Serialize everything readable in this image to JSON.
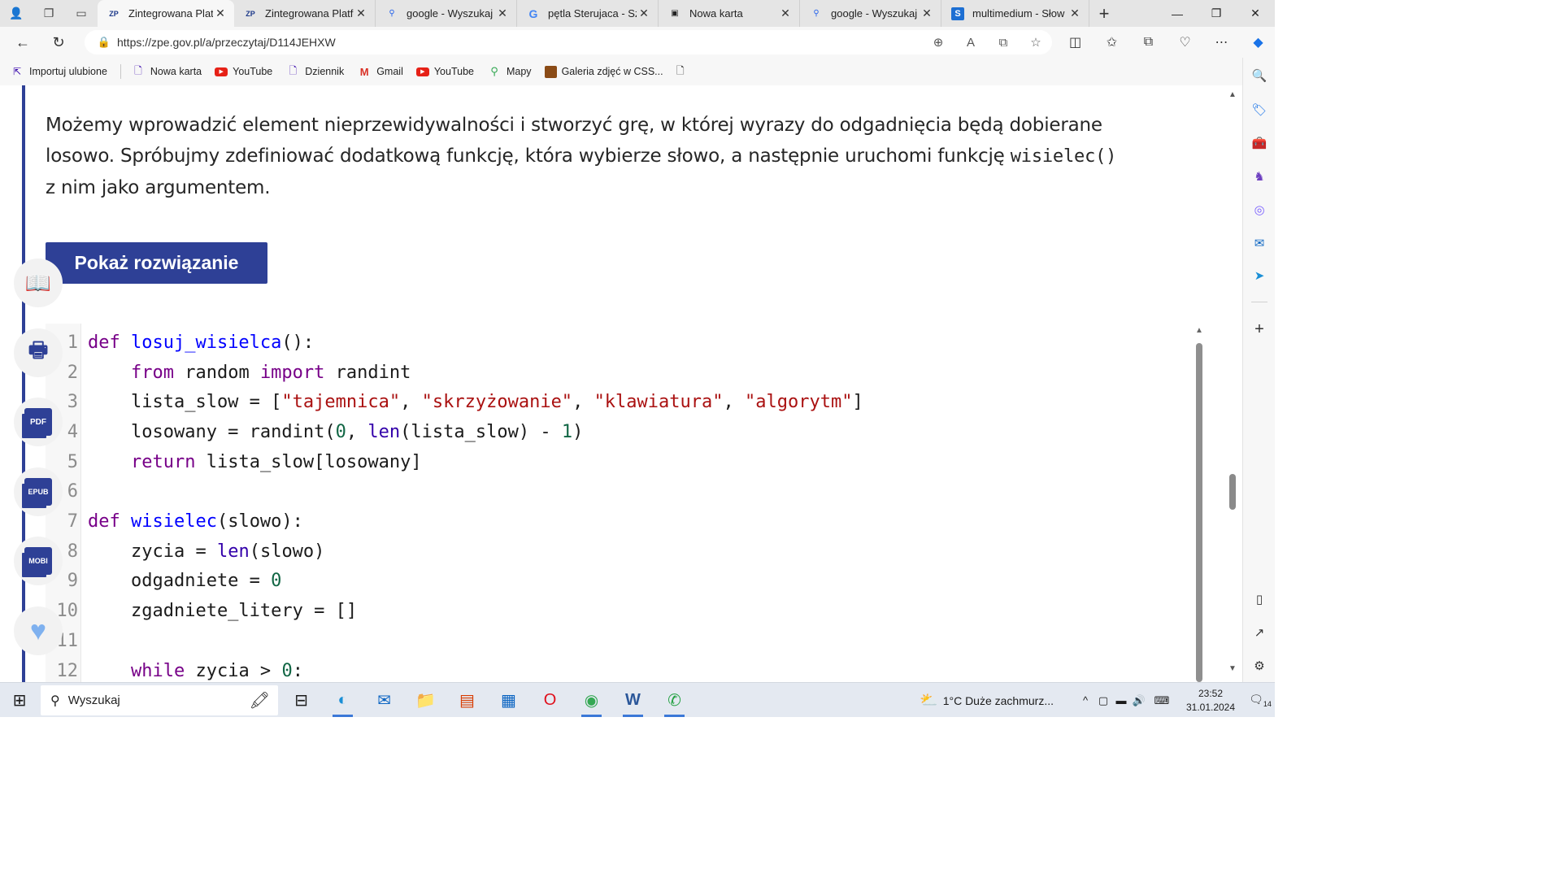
{
  "browser": {
    "tabs": [
      {
        "title": "Zintegrowana Platfo",
        "favicon": "zpe-icon",
        "favicon_text": "ZP"
      },
      {
        "title": "Zintegrowana Platfo",
        "favicon": "zpe-icon",
        "favicon_text": "ZP"
      },
      {
        "title": "google - Wyszukaj",
        "favicon": "search-icon",
        "favicon_text": "⚲"
      },
      {
        "title": "pętla Sterujaca - Szu",
        "favicon": "google-icon",
        "favicon_text": "G"
      },
      {
        "title": "Nowa karta",
        "favicon": "new-tab-icon",
        "favicon_text": "▣"
      },
      {
        "title": "google - Wyszukaj",
        "favicon": "search-icon",
        "favicon_text": "⚲"
      },
      {
        "title": "multimedium - Słow",
        "favicon": "sjp-icon",
        "favicon_text": "S"
      }
    ],
    "active_tab_index": 0,
    "url": "https://zpe.gov.pl/a/przeczytaj/D114JEHXW",
    "bookmarks": [
      {
        "label": "Importuj ulubione",
        "icon": "import-icon"
      },
      {
        "label": "Nowa karta",
        "icon": "page-icon"
      },
      {
        "label": "YouTube",
        "icon": "youtube-icon"
      },
      {
        "label": "Dziennik",
        "icon": "page-icon"
      },
      {
        "label": "Gmail",
        "icon": "gmail-icon"
      },
      {
        "label": "YouTube",
        "icon": "youtube-icon"
      },
      {
        "label": "Mapy",
        "icon": "maps-icon"
      },
      {
        "label": "Galeria zdjęć w CSS...",
        "icon": "gallery-icon"
      }
    ]
  },
  "content": {
    "paragraph_before": "Możemy wprowadzić element nieprzewidywalności i stworzyć grę, w której wyrazy do odgadnięcia będą dobierane losowo. Spróbujmy zdefiniować dodatkową funkcję, która wybierze słowo, a następnie uruchomi funkcję ",
    "paragraph_code": "wisielec()",
    "paragraph_after": " z nim jako argumentem.",
    "solution_button": "Pokaż rozwiązanie",
    "code_lines": [
      {
        "n": "1",
        "tokens": [
          [
            "kw",
            "def "
          ],
          [
            "fn",
            "losuj_wisielca"
          ],
          [
            "",
            "():"
          ]
        ]
      },
      {
        "n": "2",
        "tokens": [
          [
            "",
            "    "
          ],
          [
            "kw",
            "from"
          ],
          [
            "",
            " random "
          ],
          [
            "kw",
            "import"
          ],
          [
            "",
            " randint"
          ]
        ]
      },
      {
        "n": "3",
        "tokens": [
          [
            "",
            "    lista_slow = ["
          ],
          [
            "st",
            "\"tajemnica\""
          ],
          [
            "",
            ", "
          ],
          [
            "st",
            "\"skrzyżowanie\""
          ],
          [
            "",
            ", "
          ],
          [
            "st",
            "\"klawiatura\""
          ],
          [
            "",
            ", "
          ],
          [
            "st",
            "\"algorytm\""
          ],
          [
            "",
            "]"
          ]
        ]
      },
      {
        "n": "4",
        "tokens": [
          [
            "",
            "    losowany = randint("
          ],
          [
            "nu",
            "0"
          ],
          [
            "",
            ", "
          ],
          [
            "bi",
            "len"
          ],
          [
            "",
            "(lista_slow) - "
          ],
          [
            "nu",
            "1"
          ],
          [
            "",
            ")"
          ]
        ]
      },
      {
        "n": "5",
        "tokens": [
          [
            "",
            "    "
          ],
          [
            "kw",
            "return"
          ],
          [
            "",
            " lista_slow[losowany]"
          ]
        ]
      },
      {
        "n": "6",
        "tokens": []
      },
      {
        "n": "7",
        "tokens": [
          [
            "kw",
            "def "
          ],
          [
            "fn",
            "wisielec"
          ],
          [
            "",
            "(slowo):"
          ]
        ]
      },
      {
        "n": "8",
        "tokens": [
          [
            "",
            "    zycia = "
          ],
          [
            "bi",
            "len"
          ],
          [
            "",
            "(slowo)"
          ]
        ]
      },
      {
        "n": "9",
        "tokens": [
          [
            "",
            "    odgadniete = "
          ],
          [
            "nu",
            "0"
          ]
        ]
      },
      {
        "n": "10",
        "tokens": [
          [
            "",
            "    zgadniete_litery = []"
          ]
        ]
      },
      {
        "n": "11",
        "tokens": []
      },
      {
        "n": "12",
        "tokens": [
          [
            "",
            "    "
          ],
          [
            "kw",
            "while"
          ],
          [
            "",
            " zycia > "
          ],
          [
            "nu",
            "0"
          ],
          [
            "",
            ":"
          ]
        ]
      }
    ],
    "side_buttons": [
      {
        "name": "reader-button",
        "label": "📖"
      },
      {
        "name": "print-button",
        "label": "🖶"
      },
      {
        "name": "pdf-button",
        "label": "PDF"
      },
      {
        "name": "epub-button",
        "label": "EPUB"
      },
      {
        "name": "mobi-button",
        "label": "MOBI"
      },
      {
        "name": "favorite-button",
        "label": "♥"
      }
    ]
  },
  "taskbar": {
    "search_placeholder": "Wyszukaj",
    "weather": "1°C  Duże zachmurz...",
    "time": "23:52",
    "date": "31.01.2024",
    "notification_count": "14",
    "accent": "#3b78d8"
  },
  "colors": {
    "brand": "#2e4096",
    "keyword": "#770088",
    "function": "#0000ff",
    "string": "#aa1111",
    "number": "#116644"
  }
}
